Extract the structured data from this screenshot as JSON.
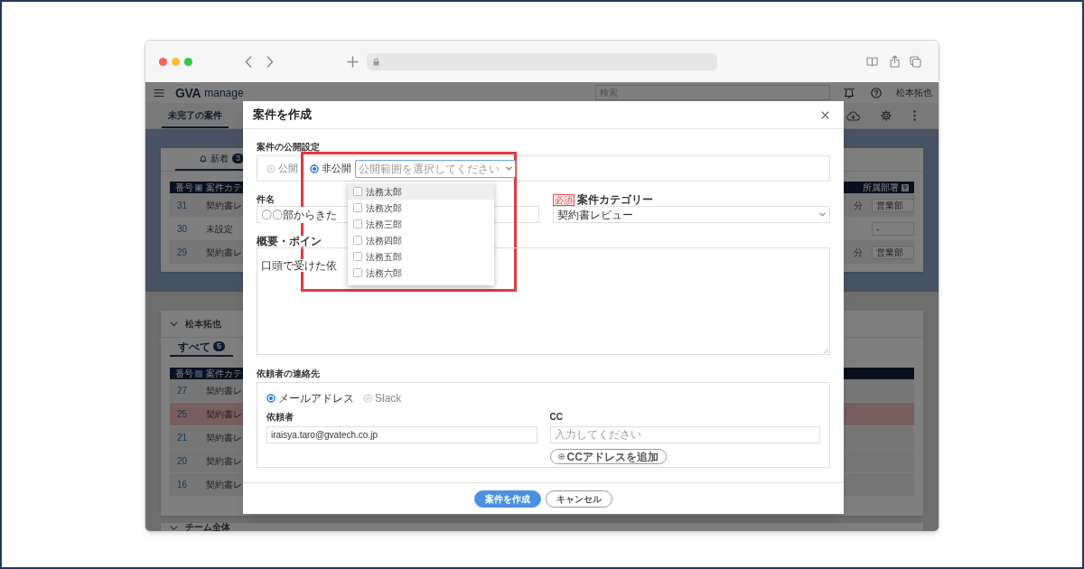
{
  "app": {
    "brand": "GVA",
    "product": "manage",
    "search_placeholder": "検索",
    "user": "松本拓也",
    "tabs": [
      {
        "label": "未完了の案件",
        "selected": true
      }
    ],
    "new_panel": {
      "tab": {
        "label": "新着",
        "count": "3",
        "selected": true
      },
      "columns": [
        "番号",
        "案件カテ",
        "所属部署"
      ],
      "rows": [
        {
          "number": "31",
          "category": "契約書レ",
          "time": "分",
          "department": "営業部"
        },
        {
          "number": "30",
          "category": "未設定",
          "department": "-"
        },
        {
          "number": "29",
          "category": "契約書レ",
          "time": "分",
          "department": "営業部"
        }
      ]
    },
    "my_panel": {
      "title": "松本拓也",
      "expanded": true,
      "tab": {
        "label": "すべて",
        "count": "5",
        "selected": true
      },
      "columns": [
        "番号",
        "案件カテ"
      ],
      "rows": [
        {
          "number": "27",
          "category": "契約書レ",
          "flagged": false
        },
        {
          "number": "25",
          "category": "契約書レ",
          "flagged": true
        },
        {
          "number": "21",
          "category": "契約書レ",
          "flagged": false
        },
        {
          "number": "20",
          "category": "契約書レ",
          "flagged": false
        },
        {
          "number": "16",
          "category": "契約書レ",
          "flagged": false
        }
      ]
    },
    "team_panel": {
      "title": "チーム全体"
    }
  },
  "modal": {
    "title": "案件を作成",
    "visibility": {
      "label": "案件の公開設定",
      "options": [
        {
          "label": "公開",
          "selected": false
        },
        {
          "label": "非公開",
          "selected": true
        }
      ],
      "scope_placeholder": "公開範囲を選択してください",
      "dropdown": [
        {
          "label": "法務太郎",
          "checked": false,
          "highlighted": true
        },
        {
          "label": "法務次郎",
          "checked": false,
          "highlighted": false
        },
        {
          "label": "法務三郎",
          "checked": false,
          "highlighted": false
        },
        {
          "label": "法務四郎",
          "checked": false,
          "highlighted": false
        },
        {
          "label": "法務五郎",
          "checked": false,
          "highlighted": false
        },
        {
          "label": "法務六郎",
          "checked": false,
          "highlighted": false
        }
      ]
    },
    "subject": {
      "label": "件名",
      "value": "〇〇部からきた"
    },
    "category": {
      "required_badge": "必須",
      "label": "案件カテゴリー",
      "value": "契約書レビュー"
    },
    "summary": {
      "label": "概要・ポイン",
      "value": "口頭で受けた依"
    },
    "contact": {
      "label": "依頼者の連絡先",
      "methods": [
        {
          "label": "メールアドレス",
          "selected": true
        },
        {
          "label": "Slack",
          "selected": false
        }
      ],
      "requester": {
        "label": "依頼者",
        "value": "iraisya.taro@gvatech.co.jp"
      },
      "cc": {
        "label": "CC",
        "placeholder": "入力してください"
      },
      "add_cc": "CCアドレスを追加"
    },
    "buttons": [
      {
        "label": "案件を作成",
        "kind": "primary"
      },
      {
        "label": "キャンセル",
        "kind": "secondary"
      }
    ]
  }
}
